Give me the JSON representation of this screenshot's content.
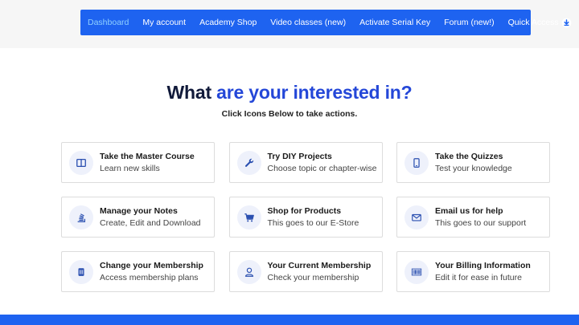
{
  "nav": {
    "items": [
      {
        "label": "Dashboard"
      },
      {
        "label": "My account"
      },
      {
        "label": "Academy Shop"
      },
      {
        "label": "Video classes (new)"
      },
      {
        "label": "Activate Serial Key"
      },
      {
        "label": "Forum (new!)"
      },
      {
        "label": "Quick Access"
      }
    ],
    "active_color": "#8fd0ff",
    "bg_color": "#1e63f0"
  },
  "heading": {
    "part1": "What",
    "part2": "are your interested in?",
    "accent_color": "#2447d8"
  },
  "subheading": "Click Icons Below to take actions.",
  "cards": [
    {
      "icon": "book-open-icon",
      "title": "Take the Master Course",
      "desc": "Learn new skills"
    },
    {
      "icon": "wrench-icon",
      "title": "Try DIY Projects",
      "desc": "Choose topic or chapter-wise"
    },
    {
      "icon": "tablet-icon",
      "title": "Take the Quizzes",
      "desc": "Test your knowledge"
    },
    {
      "icon": "notes-stack-icon",
      "title": "Manage your Notes",
      "desc": "Create, Edit and Download"
    },
    {
      "icon": "shopping-cart-icon",
      "title": "Shop for Products",
      "desc": "This goes to our E-Store"
    },
    {
      "icon": "envelope-icon",
      "title": "Email us for help",
      "desc": "This goes to our support"
    },
    {
      "icon": "membership-card-icon",
      "title": "Change your Membership",
      "desc": "Access membership plans"
    },
    {
      "icon": "user-icon",
      "title": "Your Current Membership",
      "desc": "Check your membership"
    },
    {
      "icon": "barcode-icon",
      "title": "Your Billing Information",
      "desc": "Edit it for ease in future"
    }
  ]
}
